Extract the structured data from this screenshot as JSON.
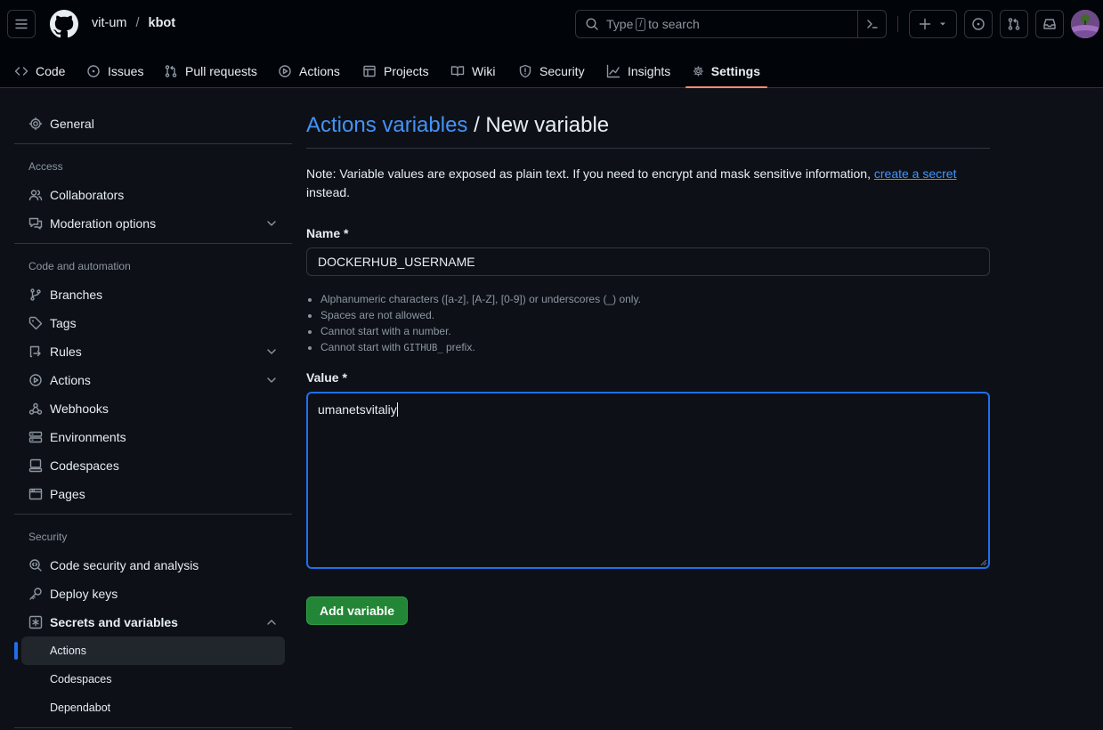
{
  "header": {
    "owner": "vit-um",
    "separator": "/",
    "repo": "kbot",
    "search_pre": "Type",
    "search_key": "/",
    "search_post": "to search"
  },
  "tabs": [
    {
      "label": "Code",
      "icon": "code-icon"
    },
    {
      "label": "Issues",
      "icon": "issue-icon"
    },
    {
      "label": "Pull requests",
      "icon": "pull-request-icon"
    },
    {
      "label": "Actions",
      "icon": "play-icon"
    },
    {
      "label": "Projects",
      "icon": "table-icon"
    },
    {
      "label": "Wiki",
      "icon": "book-icon"
    },
    {
      "label": "Security",
      "icon": "shield-icon"
    },
    {
      "label": "Insights",
      "icon": "graph-icon"
    },
    {
      "label": "Settings",
      "icon": "gear-icon",
      "selected": true
    }
  ],
  "sidebar": {
    "general": "General",
    "access_heading": "Access",
    "collaborators": "Collaborators",
    "moderation": "Moderation options",
    "code_heading": "Code and automation",
    "branches": "Branches",
    "tags": "Tags",
    "rules": "Rules",
    "actions": "Actions",
    "webhooks": "Webhooks",
    "environments": "Environments",
    "codespaces": "Codespaces",
    "pages": "Pages",
    "security_heading": "Security",
    "code_security": "Code security and analysis",
    "deploy_keys": "Deploy keys",
    "secrets": "Secrets and variables",
    "sub_actions": "Actions",
    "sub_codespaces": "Codespaces",
    "sub_dependabot": "Dependabot"
  },
  "main": {
    "title_link": "Actions variables",
    "title_rest": "/ New variable",
    "note_text": "Note: Variable values are exposed as plain text. If you need to encrypt and mask sensitive information,",
    "note_link": "create a secret",
    "note_end": "instead.",
    "name_label": "Name *",
    "name_value": "DOCKERHUB_USERNAME",
    "hint1": "Alphanumeric characters ([a-z], [A-Z], [0-9]) or underscores (_) only.",
    "hint2": "Spaces are not allowed.",
    "hint3": "Cannot start with a number.",
    "hint4_pre": "Cannot start with",
    "hint4_code": "GITHUB_",
    "hint4_post": "prefix.",
    "value_label": "Value *",
    "value_text": "umanetsvitaliy",
    "add_button": "Add variable"
  },
  "colors": {
    "accent": "#4493f8",
    "primary_button": "#238636",
    "selected_tab_underline": "#fd8c73",
    "focus_border": "#1f6feb"
  }
}
